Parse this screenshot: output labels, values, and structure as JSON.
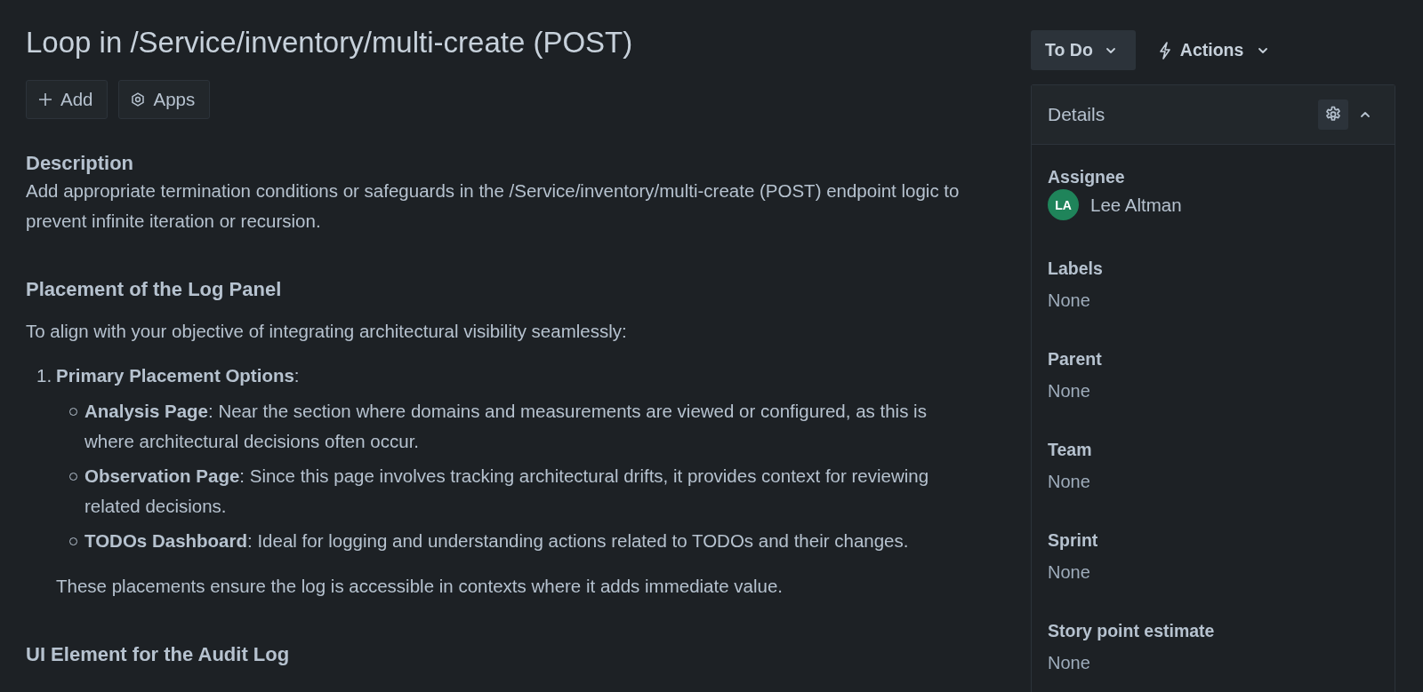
{
  "issue": {
    "title": "Loop in /Service/inventory/multi-create (POST)",
    "buttons": [
      {
        "kind": "add",
        "label": "Add"
      },
      {
        "kind": "apps",
        "label": "Apps"
      }
    ]
  },
  "description": {
    "label": "Description",
    "text": "Add appropriate termination conditions or safeguards in the /Service/inventory/multi-create (POST) endpoint logic to prevent infinite iteration or recursion.",
    "sections": [
      {
        "heading": "Placement of the Log Panel",
        "paragraph": "To align with your objective of integrating architectural visibility seamlessly:",
        "list": [
          {
            "number": "1.",
            "text": "**Primary Placement Options**:",
            "children": [
              {
                "text": "**Analysis Page**: Near the section where domains and measurements are viewed or configured, as this is where architectural decisions often occur."
              },
              {
                "text": "**Observation Page**: Since this page involves tracking architectural drifts, it provides context for reviewing related decisions."
              },
              {
                "text": "**TODOs Dashboard**: Ideal for logging and understanding actions related to TODOs and their changes."
              }
            ],
            "closing": "These placements ensure the log is accessible in contexts where it adds immediate value."
          }
        ]
      },
      {
        "heading": "UI Element for the Audit Log"
      }
    ]
  },
  "status": {
    "label": "To Do"
  },
  "actions": {
    "label": "Actions"
  },
  "details": {
    "title": "Details",
    "expanded": true,
    "fields": [
      {
        "label": "Assignee",
        "kind": "user",
        "initials": "LA",
        "value": "Lee Altman"
      },
      {
        "label": "Labels",
        "kind": "text",
        "value": "None"
      },
      {
        "label": "Parent",
        "kind": "text",
        "value": "None"
      },
      {
        "label": "Team",
        "kind": "text",
        "value": "None"
      },
      {
        "label": "Sprint",
        "kind": "text",
        "value": "None"
      },
      {
        "label": "Story point estimate",
        "kind": "text",
        "value": "None"
      }
    ]
  }
}
